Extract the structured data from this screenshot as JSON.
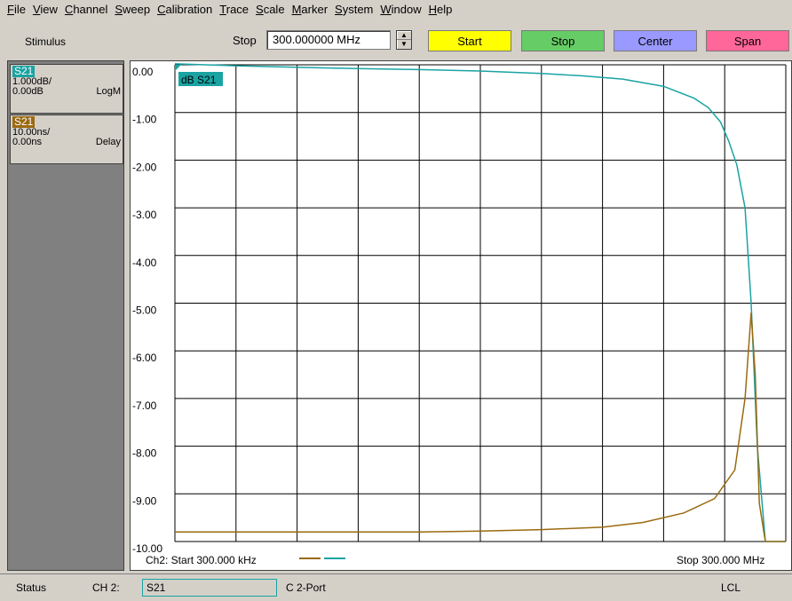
{
  "menu": [
    "File",
    "View",
    "Channel",
    "Sweep",
    "Calibration",
    "Trace",
    "Scale",
    "Marker",
    "System",
    "Window",
    "Help"
  ],
  "toolbar": {
    "stimulus_label": "Stimulus",
    "stop_label": "Stop",
    "stop_value": "300.000000 MHz",
    "start_button": "Start",
    "stop_button": "Stop",
    "center_button": "Center",
    "span_button": "Span"
  },
  "traces": [
    {
      "name": "S21",
      "scale": "1.000dB/",
      "ref": "0.00dB",
      "format": "LogM",
      "color": "#1aa3a3"
    },
    {
      "name": "S21",
      "scale": "10.00ns/",
      "ref": "0.00ns",
      "format": "Delay",
      "color": "#9b6a10"
    }
  ],
  "chart": {
    "active_label": "dB S21",
    "y_ticks": [
      "0.00",
      "-1.00",
      "-2.00",
      "-3.00",
      "-4.00",
      "-5.00",
      "-6.00",
      "-7.00",
      "-8.00",
      "-9.00",
      "-10.00"
    ],
    "footer_start": "Ch2: Start  300.000 kHz",
    "footer_stop": "Stop  300.000 MHz"
  },
  "chart_data": {
    "type": "line",
    "xlim": [
      0.3,
      300
    ],
    "ylim": [
      -10,
      0
    ],
    "series": [
      {
        "name": "S21",
        "color": "#1aa3a3",
        "x": [
          0.3,
          30,
          60,
          90,
          120,
          150,
          180,
          200,
          220,
          240,
          255,
          262,
          268,
          272,
          276,
          280,
          283,
          286,
          290,
          300
        ],
        "y": [
          0.02,
          -0.02,
          -0.05,
          -0.08,
          -0.1,
          -0.13,
          -0.18,
          -0.23,
          -0.3,
          -0.45,
          -0.7,
          -0.9,
          -1.2,
          -1.6,
          -2.1,
          -3.0,
          -5.0,
          -8.0,
          -10.0,
          -10.0
        ]
      },
      {
        "name": "S21",
        "color": "#9b6a10",
        "x": [
          0.3,
          30,
          60,
          90,
          120,
          150,
          180,
          210,
          230,
          250,
          265,
          275,
          280,
          283,
          285,
          287,
          290,
          300
        ],
        "y": [
          -9.8,
          -9.8,
          -9.8,
          -9.8,
          -9.8,
          -9.78,
          -9.75,
          -9.7,
          -9.6,
          -9.4,
          -9.1,
          -8.5,
          -7.0,
          -5.2,
          -6.5,
          -9.2,
          -10.0,
          -10.0
        ]
      }
    ]
  },
  "status": {
    "label": "Status",
    "channel": "CH 2:",
    "field": "S21",
    "cal": "C  2-Port",
    "mode": "LCL"
  }
}
